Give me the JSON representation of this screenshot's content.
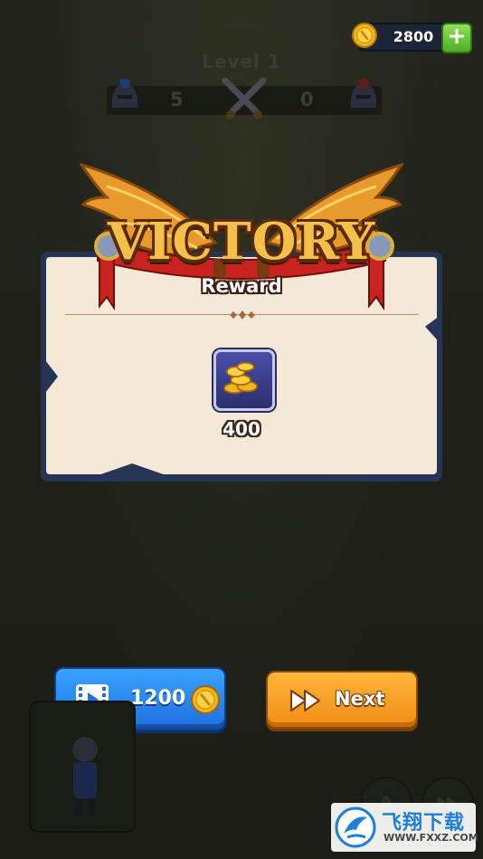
{
  "hud": {
    "coin_balance": "2800",
    "plus_label": "+",
    "level_label": "Level 1",
    "score_blue": "5",
    "score_red": "0"
  },
  "result": {
    "title": "VICTORY",
    "reward_label": "Reward",
    "reward_amount": "400",
    "reward_icon": "gold-coin-pile-icon"
  },
  "buttons": {
    "video_amount": "1200",
    "next_label": "Next"
  },
  "bottom_controls": {
    "left_button_letter": "A"
  },
  "watermark": {
    "cn_text": "飞翔下载",
    "url": "WWW.FXXZ.COM"
  },
  "colors": {
    "background": "#20221a",
    "panel_border": "#263556",
    "paper": "#f3e9d6",
    "video_button": "#2a8af0",
    "next_button": "#f8a125",
    "victory_gold": "#f5c04a",
    "ribbon_red": "#c8231e"
  }
}
